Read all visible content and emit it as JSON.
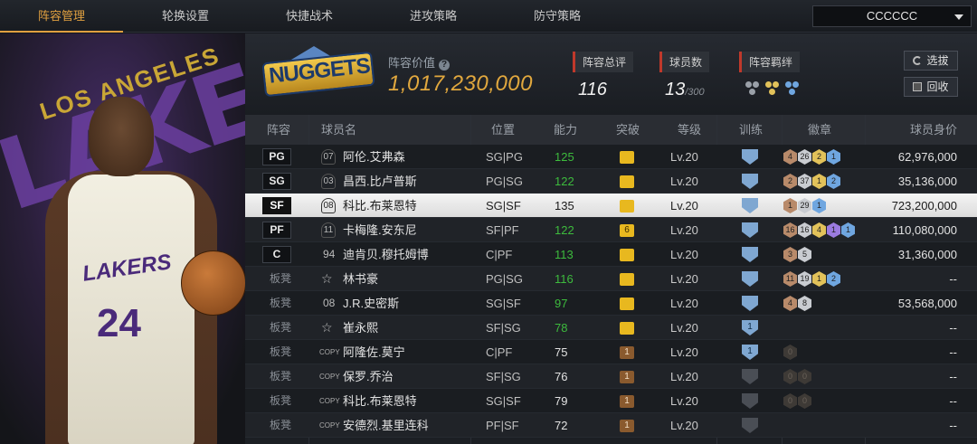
{
  "nav": {
    "tabs": [
      "阵容管理",
      "轮换设置",
      "快捷战术",
      "进攻策略",
      "防守策略"
    ],
    "active_tab": 0,
    "dropdown_value": "CCCCCC"
  },
  "left": {
    "word": "LAKERS",
    "sub": "LOS ANGELES",
    "jersey_team": "LAKERS",
    "jersey_number": "24"
  },
  "header": {
    "team_logo": "NUGGETS",
    "value_label": "阵容价值",
    "value": "1,017,230,000",
    "rating_label": "阵容总评",
    "rating": "116",
    "players_label": "球员数",
    "players_count": "13",
    "players_max": "/300",
    "synergy_label": "阵容羁绊",
    "select_button": "选拔",
    "recycle_button": "回收"
  },
  "table": {
    "headers": [
      "阵容",
      "球员名",
      "位置",
      "能力",
      "突破",
      "等级",
      "训练",
      "徽章",
      "球员身价"
    ],
    "rows": [
      {
        "slot": "PG",
        "bench": false,
        "tag": "07",
        "tagType": "jersey",
        "name": "阿伦.艾弗森",
        "pos": "SG|PG",
        "ability": "125",
        "green": true,
        "brk": "",
        "brkColor": "gold",
        "level": "Lv.20",
        "train": "",
        "trainGray": false,
        "badges": [
          [
            "bronze",
            "4"
          ],
          [
            "silver",
            "26"
          ],
          [
            "gold",
            "2"
          ],
          [
            "blue",
            "1"
          ]
        ],
        "price": "62,976,000"
      },
      {
        "slot": "SG",
        "bench": false,
        "tag": "03",
        "tagType": "jersey",
        "name": "昌西.比卢普斯",
        "pos": "PG|SG",
        "ability": "122",
        "green": true,
        "brk": "",
        "brkColor": "gold",
        "level": "Lv.20",
        "train": "",
        "trainGray": false,
        "badges": [
          [
            "bronze",
            "2"
          ],
          [
            "silver",
            "37"
          ],
          [
            "gold",
            "1"
          ],
          [
            "blue",
            "2"
          ]
        ],
        "price": "35,136,000"
      },
      {
        "slot": "SF",
        "bench": false,
        "tag": "08",
        "tagType": "jersey",
        "name": "科比.布莱恩特",
        "pos": "SG|SF",
        "ability": "135",
        "green": false,
        "brk": "",
        "brkColor": "gold",
        "level": "Lv.20",
        "train": "",
        "trainGray": false,
        "badges": [
          [
            "bronze",
            "1"
          ],
          [
            "silver",
            "29"
          ],
          [
            "blue",
            "1"
          ]
        ],
        "price": "723,200,000",
        "selected": true
      },
      {
        "slot": "PF",
        "bench": false,
        "tag": "11",
        "tagType": "jersey",
        "name": "卡梅隆.安东尼",
        "pos": "SF|PF",
        "ability": "122",
        "green": true,
        "brk": "6",
        "brkColor": "gold",
        "level": "Lv.20",
        "train": "",
        "trainGray": false,
        "badges": [
          [
            "bronze",
            "16"
          ],
          [
            "silver",
            "16"
          ],
          [
            "gold",
            "4"
          ],
          [
            "purple",
            "1"
          ],
          [
            "blue",
            "1"
          ]
        ],
        "price": "110,080,000"
      },
      {
        "slot": "C",
        "bench": false,
        "tag": "94",
        "tagType": "plain",
        "name": "迪肯贝.穆托姆博",
        "pos": "C|PF",
        "ability": "113",
        "green": true,
        "brk": "",
        "brkColor": "gold",
        "level": "Lv.20",
        "train": "",
        "trainGray": false,
        "badges": [
          [
            "bronze",
            "3"
          ],
          [
            "silver",
            "5"
          ]
        ],
        "price": "31,360,000"
      },
      {
        "slot": "板凳",
        "bench": true,
        "tag": "☆",
        "tagType": "star",
        "name": "林书豪",
        "pos": "PG|SG",
        "ability": "116",
        "green": true,
        "brk": "",
        "brkColor": "gold",
        "level": "Lv.20",
        "train": "",
        "trainGray": false,
        "badges": [
          [
            "bronze",
            "11"
          ],
          [
            "silver",
            "19"
          ],
          [
            "gold",
            "1"
          ],
          [
            "blue",
            "2"
          ]
        ],
        "price": "--"
      },
      {
        "slot": "板凳",
        "bench": true,
        "tag": "08",
        "tagType": "plain",
        "name": "J.R.史密斯",
        "pos": "SG|SF",
        "ability": "97",
        "green": true,
        "brk": "",
        "brkColor": "gold",
        "level": "Lv.20",
        "train": "",
        "trainGray": false,
        "badges": [
          [
            "bronze",
            "4"
          ],
          [
            "silver",
            "8"
          ]
        ],
        "price": "53,568,000"
      },
      {
        "slot": "板凳",
        "bench": true,
        "tag": "☆",
        "tagType": "star",
        "name": "崔永熙",
        "pos": "SF|SG",
        "ability": "78",
        "green": true,
        "brk": "",
        "brkColor": "gold",
        "level": "Lv.20",
        "train": "1",
        "trainGray": false,
        "badges": [],
        "price": "--"
      },
      {
        "slot": "板凳",
        "bench": true,
        "tag": "COPY",
        "tagType": "copy",
        "name": "阿隆佐.莫宁",
        "pos": "C|PF",
        "ability": "75",
        "green": false,
        "brk": "1",
        "brkColor": "brown",
        "level": "Lv.20",
        "train": "1",
        "trainGray": false,
        "badges": [
          [
            "dark",
            "0"
          ]
        ],
        "price": "--"
      },
      {
        "slot": "板凳",
        "bench": true,
        "tag": "COPY",
        "tagType": "copy",
        "name": "保罗.乔治",
        "pos": "SF|SG",
        "ability": "76",
        "green": false,
        "brk": "1",
        "brkColor": "brown",
        "level": "Lv.20",
        "train": "",
        "trainGray": true,
        "badges": [
          [
            "dark",
            "0"
          ],
          [
            "dark",
            "0"
          ]
        ],
        "price": "--"
      },
      {
        "slot": "板凳",
        "bench": true,
        "tag": "COPY",
        "tagType": "copy",
        "name": "科比.布莱恩特",
        "pos": "SG|SF",
        "ability": "79",
        "green": false,
        "brk": "1",
        "brkColor": "brown",
        "level": "Lv.20",
        "train": "",
        "trainGray": true,
        "badges": [
          [
            "dark",
            "0"
          ],
          [
            "dark",
            "0"
          ]
        ],
        "price": "--"
      },
      {
        "slot": "板凳",
        "bench": true,
        "tag": "COPY",
        "tagType": "copy",
        "name": "安德烈.基里连科",
        "pos": "PF|SF",
        "ability": "72",
        "green": false,
        "brk": "1",
        "brkColor": "brown",
        "level": "Lv.20",
        "train": "",
        "trainGray": true,
        "badges": [],
        "price": "--"
      }
    ]
  }
}
